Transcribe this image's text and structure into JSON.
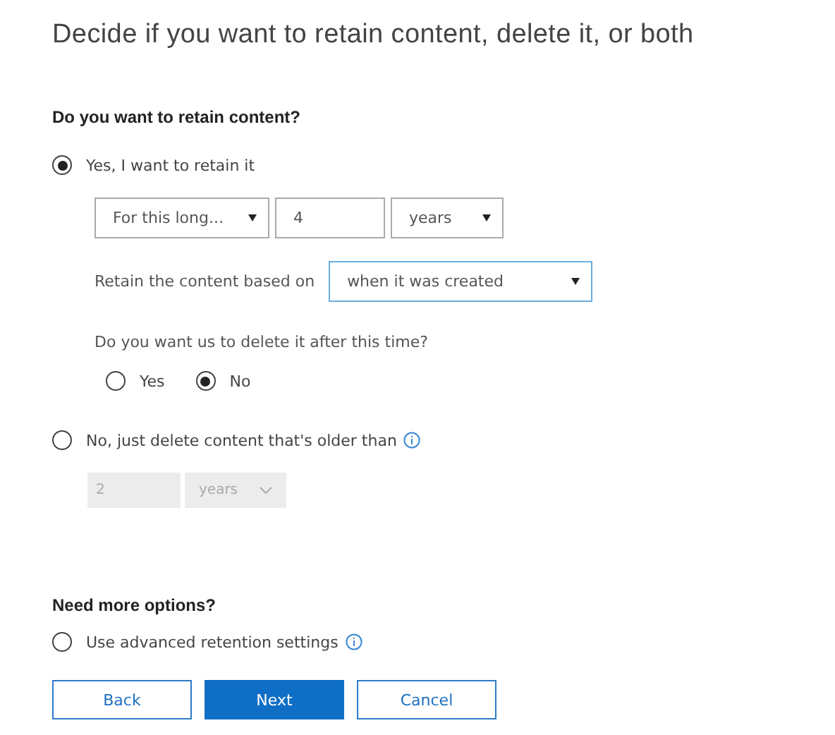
{
  "title": "Decide if you want to retain content, delete it, or both",
  "retain": {
    "heading": "Do you want to retain content?",
    "options": [
      {
        "kind": "retain",
        "label": "Yes, I want to retain it",
        "selected": true,
        "period_type": "For this long...",
        "duration": "4",
        "unit": "years",
        "based_on_label": "Retain the content based on",
        "based_on": "when it was created",
        "delete_question": "Do you want us to delete it after this time?",
        "delete_choices": [
          {
            "label": "Yes",
            "selected": false
          },
          {
            "label": "No",
            "selected": true
          }
        ]
      },
      {
        "kind": "delete",
        "label": "No, just delete content that's older than",
        "selected": false,
        "disabled": true,
        "duration": "2",
        "unit": "years"
      }
    ]
  },
  "more": {
    "heading": "Need more options?",
    "options": [
      {
        "label": "Use advanced retention settings",
        "selected": false
      }
    ]
  },
  "buttons": [
    {
      "label": "Back",
      "kind": "secondary"
    },
    {
      "label": "Next",
      "kind": "primary"
    },
    {
      "label": "Cancel",
      "kind": "secondary"
    }
  ]
}
